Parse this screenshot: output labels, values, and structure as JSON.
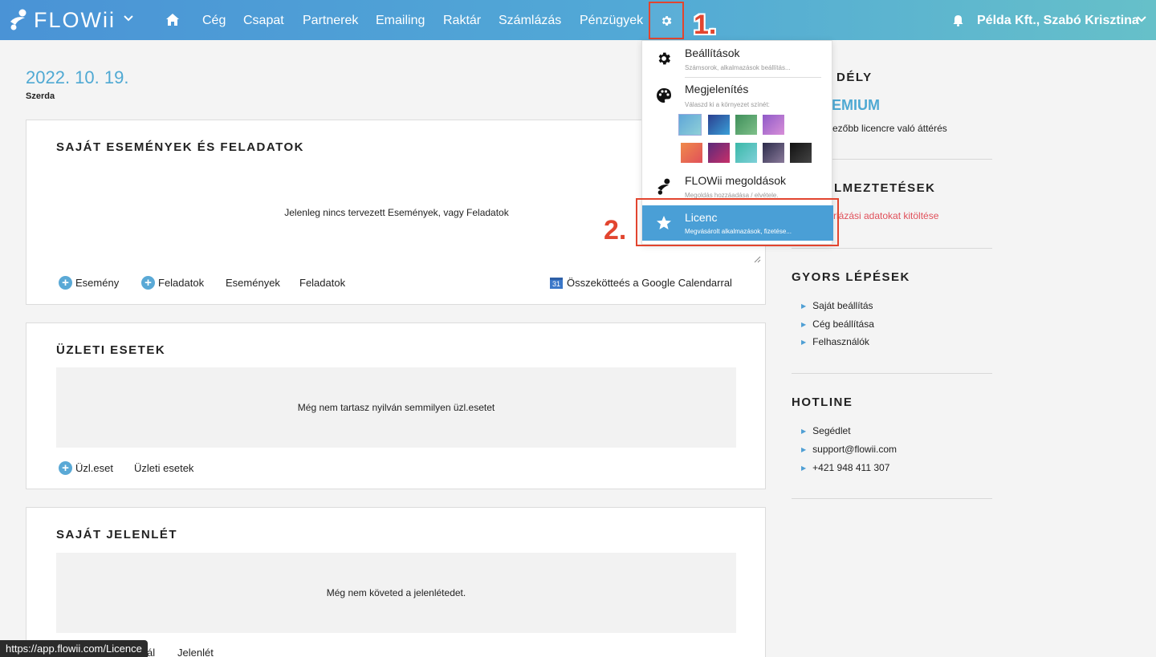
{
  "topbar": {
    "logo": "FLOWii",
    "nav": [
      "Cég",
      "Csapat",
      "Partnerek",
      "Emailing",
      "Raktár",
      "Számlázás",
      "Pénzügyek"
    ],
    "user": "Példa Kft., Szabó Krisztina",
    "step1": "1.",
    "step2": "2."
  },
  "main": {
    "date": "2022. 10. 19.",
    "day": "Szerda",
    "events": {
      "title": "SAJÁT ESEMÉNYEK ÉS FELADATOK",
      "empty": "Jelenleg nincs tervezett Események, vagy Feladatok",
      "add_event": "Esemény",
      "add_task": "Feladatok",
      "link_events": "Események",
      "link_tasks": "Feladatok",
      "calendar_day": "31",
      "google": "Összekötteés a Google Calendarral"
    },
    "business": {
      "title": "ÜZLETI ESETEK",
      "empty": "Még nem tartasz nyilván semmilyen üzl.esetet",
      "add": "Üzl.eset",
      "link": "Üzleti esetek"
    },
    "attendance": {
      "title": "SAJÁT JELENLÉT",
      "empty": "Még nem követed a jelenlétedet.",
      "partial": "ál",
      "link": "Jelenlét"
    }
  },
  "side": {
    "licence_title": "DÉLY",
    "licence_plan": "EMIUM",
    "licence_upgrade": "ezőbb licencre való áttérés",
    "alerts_title": "LMEZTETÉSEK",
    "alerts_link": "rlázási adatokat kitöltése",
    "quick_title": "GYORS LÉPÉSEK",
    "quick": [
      "Saját beállítás",
      "Cég beállítása",
      "Felhasználók"
    ],
    "hotline_title": "HOTLINE",
    "hotline": [
      "Segédlet",
      "support@flowii.com",
      "+421 948 411 307"
    ]
  },
  "dropdown": {
    "settings_title": "Beállítások",
    "settings_sub": "Számsorok, alkalmazások beállítás...",
    "display_title": "Megjelenítés",
    "display_sub": "Válaszd ki a környezet színét:",
    "solutions_title": "FLOWii megoldások",
    "solutions_sub": "Megoldás hozzáadása / elvétele.",
    "licence_title": "Licenc",
    "licence_sub": "Megvásárolt alkalmazások, fizetése...",
    "swatches": [
      [
        "#5fa6d8",
        "#8fd0d8"
      ],
      [
        "#2b3f8f",
        "#3aa0d8"
      ],
      [
        "#3f8f5a",
        "#7fc08a"
      ],
      [
        "#8f5ac8",
        "#d88fd8"
      ],
      [
        "#f08a4a",
        "#e0505a"
      ],
      [
        "#5a2a7a",
        "#c8306a"
      ],
      [
        "#3ab8a8",
        "#7fd0d8"
      ],
      [
        "#2b2b4a",
        "#8a7a9a"
      ],
      [
        "#111111",
        "#444444"
      ]
    ]
  },
  "status_url": "https://app.flowii.com/Licence"
}
